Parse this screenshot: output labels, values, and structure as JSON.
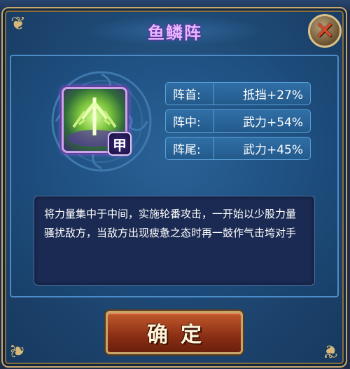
{
  "dialog": {
    "title": "鱼鳞阵",
    "close_icon": "close-x-icon",
    "skill_icon": "formation-skill-icon",
    "grade_badge": "甲",
    "stats": [
      {
        "label": "阵首:",
        "value": "抵挡+27%"
      },
      {
        "label": "阵中:",
        "value": "武力+54%"
      },
      {
        "label": "阵尾:",
        "value": "武力+45%"
      }
    ],
    "description": "将力量集中于中间，实施轮番攻击，一开始以少股力量骚扰敌方，当敌方出现疲惫之态时再一鼓作气击垮对手",
    "confirm_label": "确定"
  },
  "colors": {
    "title": "#e6b8ff",
    "panel": "#1f4a76",
    "frame_gold": "#c9a86b",
    "confirm_button": "#8a2e14",
    "close_x": "#d44a2a"
  }
}
